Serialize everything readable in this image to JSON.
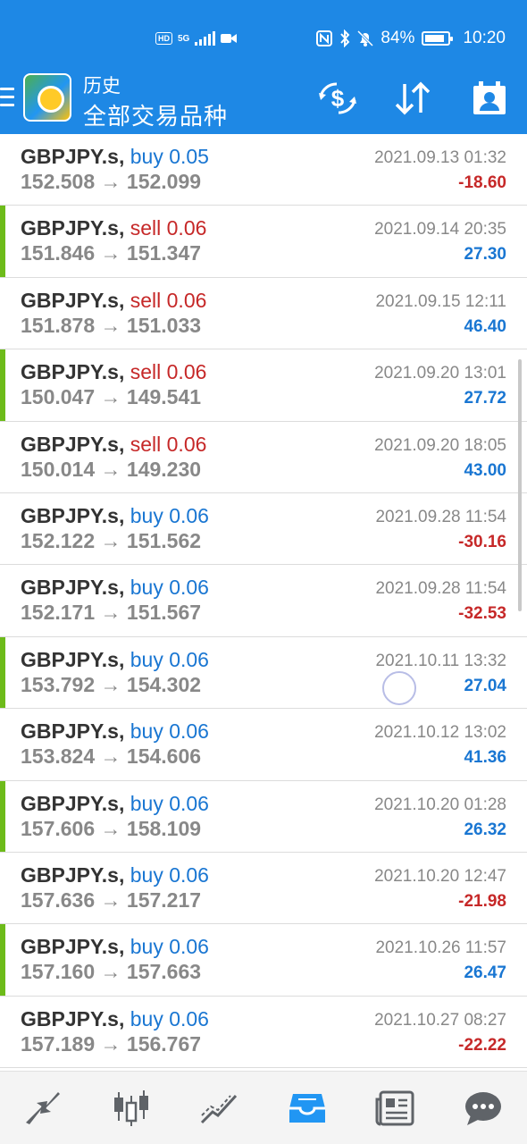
{
  "status_bar": {
    "network_badge": "HD",
    "signal_label": "5G",
    "battery": "84%",
    "battery_level": 0.84,
    "time": "10:20"
  },
  "header": {
    "subtitle": "历史",
    "title": "全部交易品种",
    "icons": [
      "menu-icon",
      "app-logo",
      "currency-exchange-icon",
      "sort-icon",
      "account-icon"
    ]
  },
  "trades": [
    {
      "symbol": "GBPJPY.s,",
      "side": "buy",
      "volume": "0.05",
      "side_label": "buy 0.05",
      "open": "152.508",
      "close": "152.099",
      "arrow": "→",
      "time": "2021.09.13 01:32",
      "profit": "-18.60",
      "positive": false,
      "accent": false
    },
    {
      "symbol": "GBPJPY.s,",
      "side": "sell",
      "volume": "0.06",
      "side_label": "sell 0.06",
      "open": "151.846",
      "close": "151.347",
      "arrow": "→",
      "time": "2021.09.14 20:35",
      "profit": "27.30",
      "positive": true,
      "accent": true
    },
    {
      "symbol": "GBPJPY.s,",
      "side": "sell",
      "volume": "0.06",
      "side_label": "sell 0.06",
      "open": "151.878",
      "close": "151.033",
      "arrow": "→",
      "time": "2021.09.15 12:11",
      "profit": "46.40",
      "positive": true,
      "accent": false
    },
    {
      "symbol": "GBPJPY.s,",
      "side": "sell",
      "volume": "0.06",
      "side_label": "sell 0.06",
      "open": "150.047",
      "close": "149.541",
      "arrow": "→",
      "time": "2021.09.20 13:01",
      "profit": "27.72",
      "positive": true,
      "accent": true
    },
    {
      "symbol": "GBPJPY.s,",
      "side": "sell",
      "volume": "0.06",
      "side_label": "sell 0.06",
      "open": "150.014",
      "close": "149.230",
      "arrow": "→",
      "time": "2021.09.20 18:05",
      "profit": "43.00",
      "positive": true,
      "accent": false
    },
    {
      "symbol": "GBPJPY.s,",
      "side": "buy",
      "volume": "0.06",
      "side_label": "buy 0.06",
      "open": "152.122",
      "close": "151.562",
      "arrow": "→",
      "time": "2021.09.28 11:54",
      "profit": "-30.16",
      "positive": false,
      "accent": false
    },
    {
      "symbol": "GBPJPY.s,",
      "side": "buy",
      "volume": "0.06",
      "side_label": "buy 0.06",
      "open": "152.171",
      "close": "151.567",
      "arrow": "→",
      "time": "2021.09.28 11:54",
      "profit": "-32.53",
      "positive": false,
      "accent": false
    },
    {
      "symbol": "GBPJPY.s,",
      "side": "buy",
      "volume": "0.06",
      "side_label": "buy 0.06",
      "open": "153.792",
      "close": "154.302",
      "arrow": "→",
      "time": "2021.10.11 13:32",
      "profit": "27.04",
      "positive": true,
      "accent": true
    },
    {
      "symbol": "GBPJPY.s,",
      "side": "buy",
      "volume": "0.06",
      "side_label": "buy 0.06",
      "open": "153.824",
      "close": "154.606",
      "arrow": "→",
      "time": "2021.10.12 13:02",
      "profit": "41.36",
      "positive": true,
      "accent": false
    },
    {
      "symbol": "GBPJPY.s,",
      "side": "buy",
      "volume": "0.06",
      "side_label": "buy 0.06",
      "open": "157.606",
      "close": "158.109",
      "arrow": "→",
      "time": "2021.10.20 01:28",
      "profit": "26.32",
      "positive": true,
      "accent": true
    },
    {
      "symbol": "GBPJPY.s,",
      "side": "buy",
      "volume": "0.06",
      "side_label": "buy 0.06",
      "open": "157.636",
      "close": "157.217",
      "arrow": "→",
      "time": "2021.10.20 12:47",
      "profit": "-21.98",
      "positive": false,
      "accent": false
    },
    {
      "symbol": "GBPJPY.s,",
      "side": "buy",
      "volume": "0.06",
      "side_label": "buy 0.06",
      "open": "157.160",
      "close": "157.663",
      "arrow": "→",
      "time": "2021.10.26 11:57",
      "profit": "26.47",
      "positive": true,
      "accent": true
    },
    {
      "symbol": "GBPJPY.s,",
      "side": "buy",
      "volume": "0.06",
      "side_label": "buy 0.06",
      "open": "157.189",
      "close": "156.767",
      "arrow": "→",
      "time": "2021.10.27 08:27",
      "profit": "-22.22",
      "positive": false,
      "accent": false
    }
  ],
  "bottom_nav": [
    {
      "name": "nav-quotes",
      "icon": "trade-arrows-icon",
      "active": false
    },
    {
      "name": "nav-chart",
      "icon": "candlestick-icon",
      "active": false
    },
    {
      "name": "nav-trade",
      "icon": "trend-lines-icon",
      "active": false
    },
    {
      "name": "nav-history",
      "icon": "inbox-tray-icon",
      "active": true
    },
    {
      "name": "nav-news",
      "icon": "newspaper-icon",
      "active": false
    },
    {
      "name": "nav-chat",
      "icon": "chat-bubble-icon",
      "active": false
    }
  ],
  "colors": {
    "header_blue": "#1e88e5",
    "buy_blue": "#1976d2",
    "sell_red": "#c62828",
    "accent_green": "#6dbb1a",
    "nav_active": "#2196f3",
    "nav_inactive": "#5f6368"
  }
}
